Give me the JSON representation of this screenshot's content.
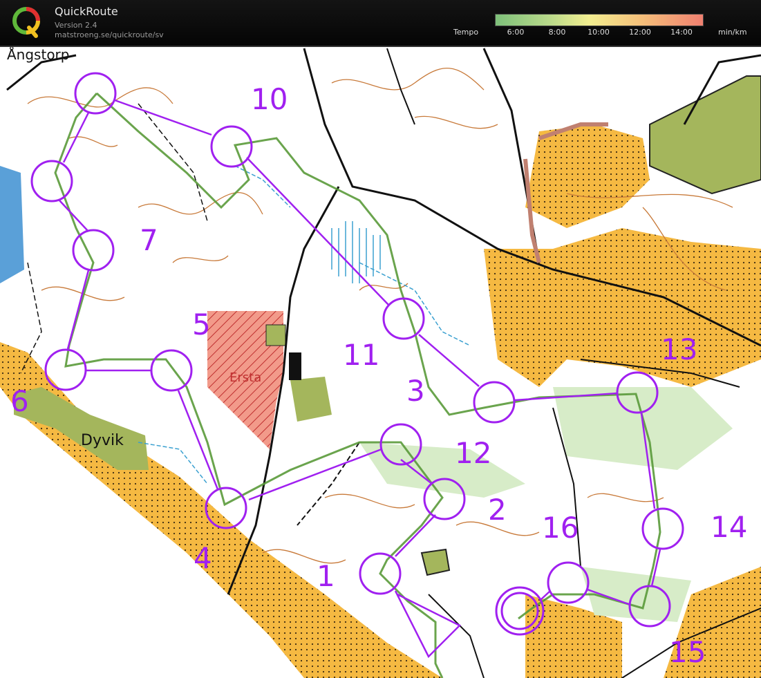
{
  "app": {
    "title": "QuickRoute",
    "version": "Version 2.4",
    "url": "matstroeng.se/quickroute/sv",
    "logo_letter": "Q"
  },
  "legend": {
    "tempo_label": "Tempo",
    "unit_label": "min/km",
    "ticks": [
      "6:00",
      "8:00",
      "10:00",
      "12:00",
      "14:00"
    ],
    "gradient_colors": [
      "#7ec07a",
      "#b7d98a",
      "#f2ee90",
      "#f5c07a",
      "#ef8070"
    ]
  },
  "map": {
    "place_names": [
      "Ångstorp",
      "Dyvik",
      "Ersta"
    ],
    "control_numbers": [
      "1",
      "2",
      "3",
      "4",
      "5",
      "6",
      "7",
      "10",
      "11",
      "12",
      "13",
      "14",
      "15",
      "16"
    ],
    "course_color": "#a020f0",
    "route_color": "#5a9a3a"
  }
}
